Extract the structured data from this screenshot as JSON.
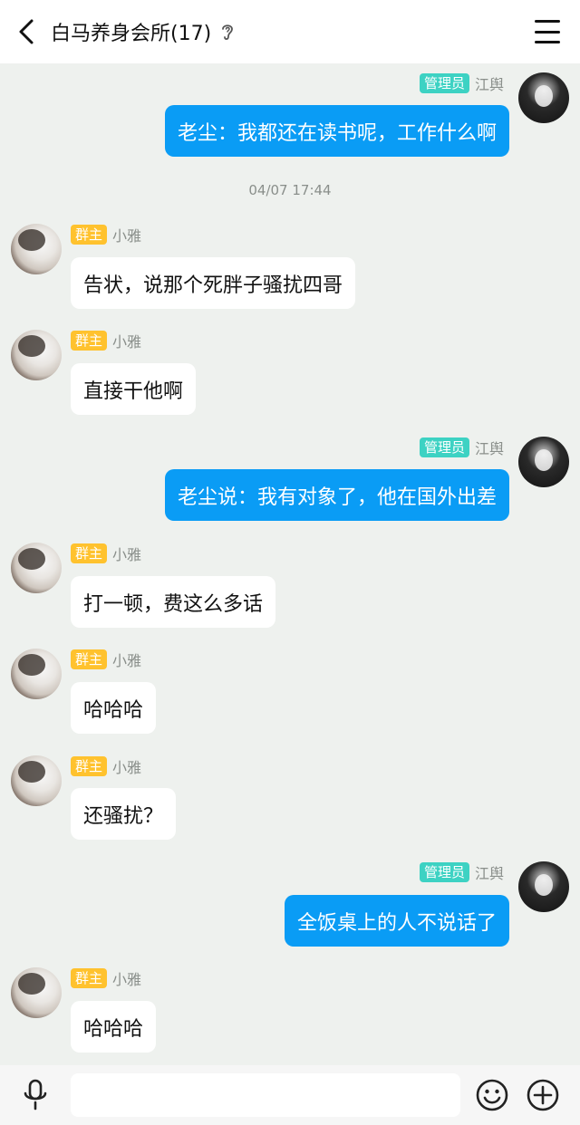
{
  "header": {
    "title": "白马养身会所(17)"
  },
  "icons": {
    "back": "chevron-left-icon",
    "ear": "ear-icon",
    "menu": "menu-icon",
    "mic": "microphone-icon",
    "emoji": "emoji-icon",
    "plus": "plus-icon"
  },
  "colors": {
    "outgoing_bubble": "#0a9cf5",
    "incoming_bubble": "#ffffff",
    "owner_badge": "#ffc22e",
    "admin_badge": "#3dd2c3",
    "background": "#eef1ee"
  },
  "chat": {
    "timestamp": "04/07 17:44",
    "messages": [
      {
        "side": "right",
        "badge": "管理员",
        "name": "江舆",
        "text": "老尘：我都还在读书呢，工作什么啊"
      },
      {
        "side": "left",
        "badge": "群主",
        "name": "小雅",
        "text": "告状，说那个死胖子骚扰四哥"
      },
      {
        "side": "left",
        "badge": "群主",
        "name": "小雅",
        "text": "直接干他啊"
      },
      {
        "side": "right",
        "badge": "管理员",
        "name": "江舆",
        "text": "老尘说：我有对象了，他在国外出差"
      },
      {
        "side": "left",
        "badge": "群主",
        "name": "小雅",
        "text": "打一顿，费这么多话"
      },
      {
        "side": "left",
        "badge": "群主",
        "name": "小雅",
        "text": "哈哈哈"
      },
      {
        "side": "left",
        "badge": "群主",
        "name": "小雅",
        "text": "还骚扰？"
      },
      {
        "side": "right",
        "badge": "管理员",
        "name": "江舆",
        "text": "全饭桌上的人不说话了"
      },
      {
        "side": "left",
        "badge": "群主",
        "name": "小雅",
        "text": "哈哈哈"
      }
    ]
  },
  "input": {
    "value": "",
    "placeholder": ""
  }
}
